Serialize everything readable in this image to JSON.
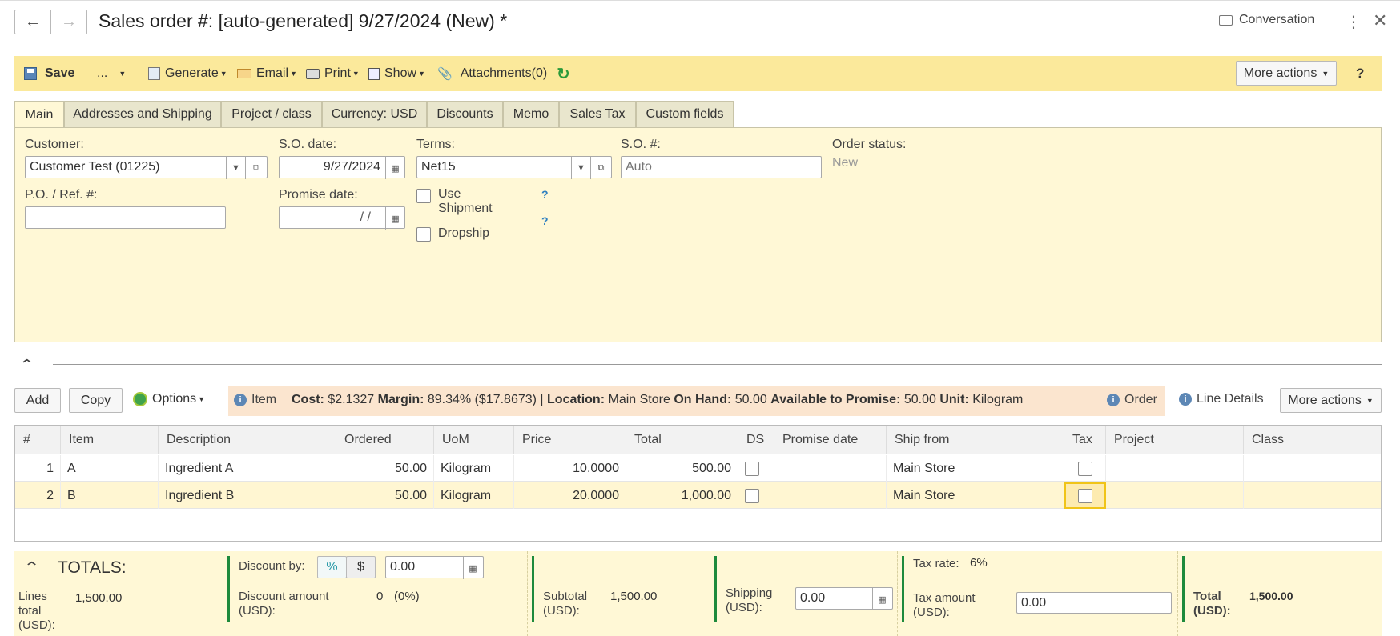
{
  "header": {
    "title": "Sales order #: [auto-generated] 9/27/2024 (New) *",
    "conversation_label": "Conversation"
  },
  "toolbar": {
    "save_label": "Save",
    "more_label": "...",
    "generate_label": "Generate",
    "email_label": "Email",
    "print_label": "Print",
    "show_label": "Show",
    "attachments_label": "Attachments(0)",
    "more_actions_label": "More actions",
    "help_label": "?"
  },
  "tabs": [
    {
      "label": "Main"
    },
    {
      "label": "Addresses and Shipping"
    },
    {
      "label": "Project / class"
    },
    {
      "label": "Currency: USD"
    },
    {
      "label": "Discounts"
    },
    {
      "label": "Memo"
    },
    {
      "label": "Sales Tax"
    },
    {
      "label": "Custom fields"
    }
  ],
  "form": {
    "customer_label": "Customer:",
    "customer_value": "Customer Test (01225)",
    "so_date_label": "S.O. date:",
    "so_date_value": "9/27/2024",
    "terms_label": "Terms:",
    "terms_value": "Net15",
    "so_number_label": "S.O. #:",
    "so_number_placeholder": "Auto",
    "order_status_label": "Order status:",
    "order_status_value": "New",
    "po_ref_label": "P.O. / Ref. #:",
    "po_ref_value": "",
    "promise_date_label": "Promise date:",
    "promise_date_value": "/  /",
    "use_shipment_label": "Use Shipment",
    "dropship_label": "Dropship",
    "help_mark": "?"
  },
  "lines_toolbar": {
    "add_label": "Add",
    "copy_label": "Copy",
    "options_label": "Options",
    "item_label": "Item",
    "cost_label": "Cost:",
    "cost_value": "$2.1327",
    "margin_label": "Margin:",
    "margin_value": "89.34% ($17.8673) |",
    "location_label": "Location:",
    "location_value": "Main Store",
    "on_hand_label": "On Hand:",
    "on_hand_value": "50.00",
    "atp_label": "Available to Promise:",
    "atp_value": "50.00",
    "unit_label": "Unit:",
    "unit_value": "Kilogram",
    "order_label": "Order",
    "line_details_label": "Line Details",
    "more_actions_label": "More actions"
  },
  "grid": {
    "columns": [
      "#",
      "Item",
      "Description",
      "Ordered",
      "UoM",
      "Price",
      "Total",
      "DS",
      "Promise date",
      "Ship from",
      "Tax",
      "Project",
      "Class"
    ],
    "rows": [
      {
        "num": "1",
        "item": "A",
        "description": "Ingredient A",
        "ordered": "50.00",
        "uom": "Kilogram",
        "price": "10.0000",
        "total": "500.00",
        "ship_from": "Main Store"
      },
      {
        "num": "2",
        "item": "B",
        "description": "Ingredient B",
        "ordered": "50.00",
        "uom": "Kilogram",
        "price": "20.0000",
        "total": "1,000.00",
        "ship_from": "Main Store"
      }
    ]
  },
  "totals": {
    "heading": "TOTALS:",
    "lines_total_label": "Lines total (USD):",
    "lines_total_value": "1,500.00",
    "discount_by_label": "Discount by:",
    "discount_pct": "%",
    "discount_dollar": "$",
    "discount_value": "0.00",
    "discount_amount_label": "Discount amount (USD):",
    "discount_amount_value": "0",
    "discount_amount_pct": "(0%)",
    "subtotal_label": "Subtotal (USD):",
    "subtotal_value": "1,500.00",
    "shipping_label": "Shipping (USD):",
    "shipping_value": "0.00",
    "tax_rate_label": "Tax rate:",
    "tax_rate_value": "6%",
    "tax_amount_label": "Tax amount (USD):",
    "tax_amount_value": "0.00",
    "total_label": "Total (USD):",
    "total_value": "1,500.00"
  },
  "colors": {
    "toolbar_bg": "#fbe99b",
    "panel_bg": "#fff8d6",
    "accent_green": "#1e8a3c",
    "info_blue": "#2f80c0"
  }
}
